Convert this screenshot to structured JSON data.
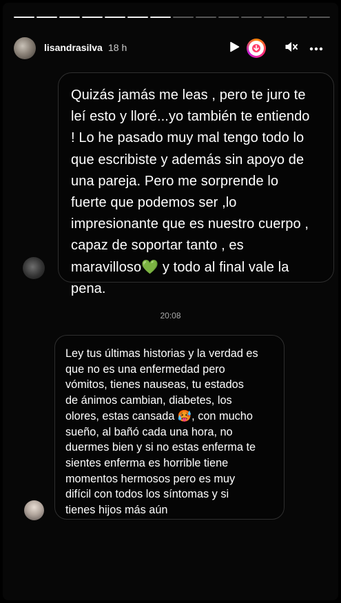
{
  "story": {
    "segments_total": 14,
    "segments_done": 7
  },
  "header": {
    "username": "lisandrasilva",
    "time": "18 h",
    "icons": [
      "play-icon",
      "sticker-icon",
      "mute-icon",
      "more-icon"
    ]
  },
  "messages": [
    {
      "lines": [
        "Quizás jamás me leas , pero te juro te",
        "leí esto y lloré...yo también te entiendo",
        "! Lo he pasado muy mal tengo todo lo",
        "que escribiste y además sin apoyo de",
        "una pareja. Pero me sorprende lo",
        "fuerte que podemos ser ,lo",
        "impresionante que es nuestro cuerpo ,",
        "capaz de soportar tanto , es",
        "maravilloso💚 y todo al final vale la",
        "pena."
      ]
    },
    {
      "timestamp": "20:08",
      "lines": [
        "Ley tus últimas historias y la verdad es",
        "que no es una enfermedad pero",
        "vómitos, tienes nauseas, tu estados",
        "de ánimos cambian, diabetes, los",
        "olores, estas cansada 🥵, con mucho",
        "sueño, al bañó cada una hora, no",
        "duermes bien y si no estas enferma te",
        "sientes enferma es horrible tiene",
        "momentos hermosos pero es muy",
        "difícil con todos los síntomas y si",
        "tienes hijos más aún"
      ]
    }
  ],
  "colors": {
    "background": "#070707",
    "bubble_border": "#2f2f2f",
    "text": "#ffffff"
  }
}
